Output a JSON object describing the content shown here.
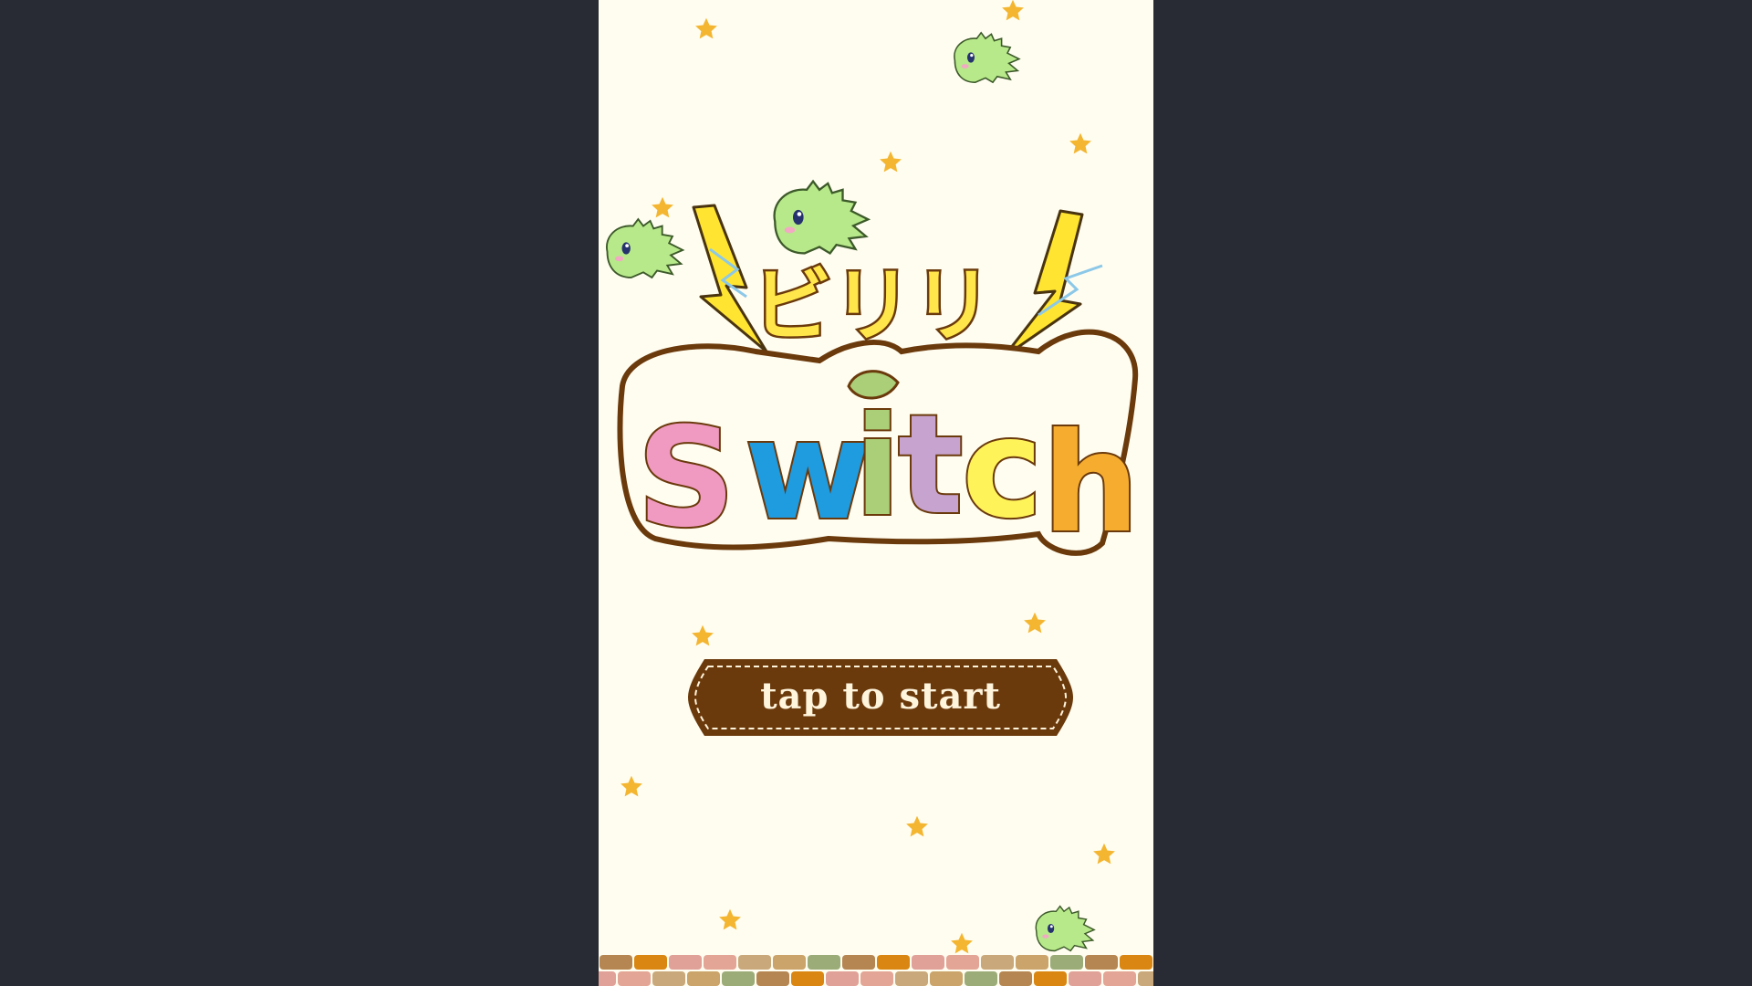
{
  "title_logo": {
    "katakana": "ビリリ",
    "word": "Switch",
    "letter_colors": [
      "#f09ac2",
      "#1f9be0",
      "#aacf78",
      "#c7a3cf",
      "#fff35a",
      "#f6ad2f"
    ]
  },
  "start_button": {
    "label": "tap to start",
    "color": "#6b3a0c"
  },
  "colors": {
    "page_background": "#282b34",
    "stage_background": "#fffdf0",
    "star": "#f4b631",
    "creature": "#b7e98a",
    "outline": "#6b3a0c"
  },
  "decorations": {
    "star_icon": "star-icon",
    "creature_icon": "green-fuzzball-creature",
    "lightning_icon": "lightning-bolt-icon"
  }
}
